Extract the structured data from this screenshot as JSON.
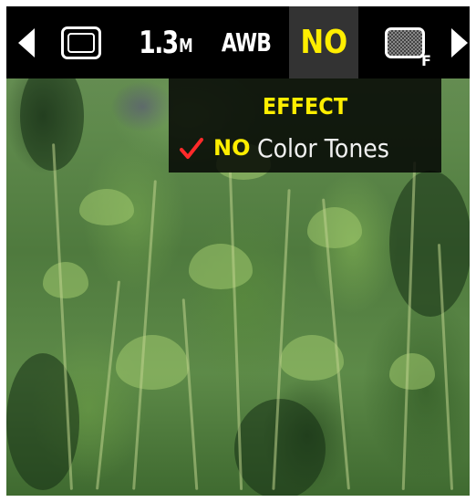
{
  "toolbar": {
    "prev_icon": "arrow-left-icon",
    "frame_icon": "frame-icon",
    "resolution_value": "1.3",
    "resolution_unit": "M",
    "white_balance": "AWB",
    "effect_selected": "NO",
    "flash_icon": "flash-mode-icon",
    "flash_sub": "F",
    "next_icon": "arrow-right-icon",
    "selected_color": "#ffee00"
  },
  "effect_menu": {
    "title": "EFFECT",
    "items": [
      {
        "code": "NO",
        "label": "Color Tones",
        "checked": true,
        "check_color": "#ff2a2a"
      }
    ]
  }
}
